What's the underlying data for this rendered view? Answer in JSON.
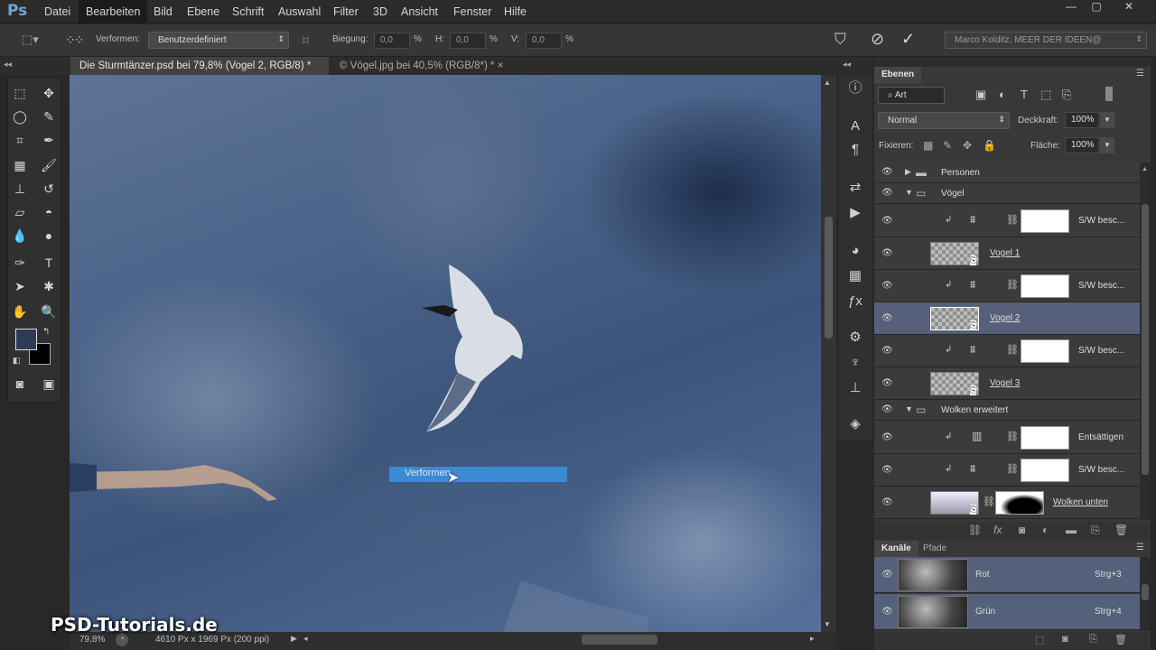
{
  "app": {
    "logo": "Ps"
  },
  "menu": [
    "Datei",
    "Bearbeiten",
    "Bild",
    "Ebene",
    "Schrift",
    "Auswahl",
    "Filter",
    "3D",
    "Ansicht",
    "Fenster",
    "Hilfe"
  ],
  "window_controls": {
    "minimize": "—",
    "restore": "▢",
    "close": "✕"
  },
  "options": {
    "warp_label": "Verformen:",
    "warp_value": "Benutzerdefiniert",
    "bend_label": "Biegung:",
    "bend_value": "0,0",
    "h_label": "H:",
    "h_value": "0,0",
    "v_label": "V:",
    "v_value": "0,0",
    "percent": "%",
    "workspace": "Marco Kolditz, MEER DER IDEEN@",
    "cancel_icon": "cancel-icon",
    "commit_icon": "checkmark-icon"
  },
  "tabs": [
    {
      "label": "Die Sturmtänzer.psd bei 79,8% (Vogel 2, RGB/8) *",
      "close": "×"
    },
    {
      "label": "© Vögel.jpg bei 40,5% (RGB/8*) *",
      "close": "×"
    }
  ],
  "canvas": {
    "warp_tooltip": "Verformen"
  },
  "status": {
    "zoom": "79,8%",
    "doc_info": "4610 Px x 1969 Px (200 ppi)"
  },
  "watermark": "PSD-Tutorials.de",
  "layers_panel": {
    "tab": "Ebenen",
    "filter_kind": "Art",
    "blend_mode": "Normal",
    "opacity_label": "Deckkraft:",
    "opacity_value": "100%",
    "lock_label": "Fixieren:",
    "fill_label": "Fläche:",
    "fill_value": "100%",
    "items": [
      {
        "type": "group",
        "name": "Personen",
        "expanded": false
      },
      {
        "type": "group",
        "name": "Vögel",
        "expanded": true
      },
      {
        "type": "adj",
        "name": "S/W besc..."
      },
      {
        "type": "smart",
        "name": "Vogel 1"
      },
      {
        "type": "adj",
        "name": "S/W besc..."
      },
      {
        "type": "smart",
        "name": "Vogel 2",
        "selected": true
      },
      {
        "type": "adj",
        "name": "S/W besc..."
      },
      {
        "type": "smart",
        "name": "Vogel 3"
      },
      {
        "type": "group",
        "name": "Wolken erweitert",
        "expanded": true
      },
      {
        "type": "adj2",
        "name": "Entsättigen"
      },
      {
        "type": "adj",
        "name": "S/W besc..."
      },
      {
        "type": "masked",
        "name": "Wolken unten"
      }
    ]
  },
  "channels_panel": {
    "tabs": [
      "Kanäle",
      "Pfade"
    ],
    "rows": [
      {
        "name": "Rot",
        "shortcut": "Strg+3"
      },
      {
        "name": "Grün",
        "shortcut": "Strg+4"
      }
    ]
  },
  "colors": {
    "accent": "#3a8ad4",
    "selected_layer": "#56607a",
    "foreground": "#2d3b55",
    "background": "#000000"
  }
}
